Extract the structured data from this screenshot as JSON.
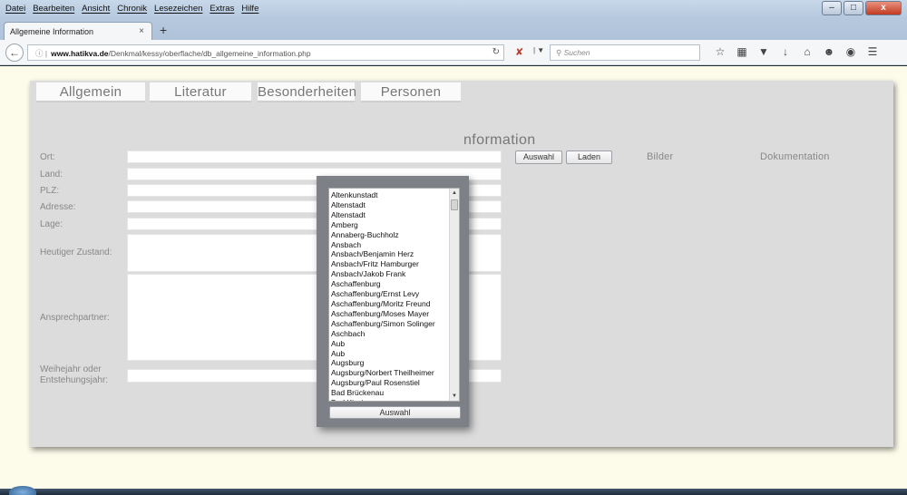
{
  "menubar": {
    "items": [
      "Datei",
      "Bearbeiten",
      "Ansicht",
      "Chronik",
      "Lesezeichen",
      "Extras",
      "Hilfe"
    ]
  },
  "window_controls": {
    "minimize": "–",
    "maximize": "□",
    "close": "x"
  },
  "tab": {
    "title": "Allgemeine Information",
    "close": "×",
    "new_tab": "+"
  },
  "navbar": {
    "url_host": "www.hatikva.de",
    "url_path": "/Denkmal/kessy/oberflache/db_allgemeine_information.php",
    "search_placeholder": "Suchen"
  },
  "page": {
    "tabs": [
      "Allgemein",
      "Literatur",
      "Besonderheiten",
      "Personen"
    ],
    "heading_visible": "nformation",
    "fields": [
      {
        "label": "Ort:"
      },
      {
        "label": "Land:"
      },
      {
        "label": "PLZ:"
      },
      {
        "label": "Adresse:"
      },
      {
        "label": "Lage:"
      },
      {
        "label": "Heutiger Zustand:"
      },
      {
        "label": "Ansprechpartner:"
      },
      {
        "label_line1": "Weihejahr oder",
        "label_line2": "Entstehungsjahr:"
      }
    ],
    "buttons": {
      "auswahl": "Auswahl",
      "laden": "Laden"
    },
    "columns": {
      "bilder": "Bilder",
      "dokumentation": "Dokumentation"
    }
  },
  "modal": {
    "items": [
      "Altenkunstadt",
      "Altenstadt",
      "Altenstadt",
      "Amberg",
      "Annaberg-Buchholz",
      "Ansbach",
      "Ansbach/Benjamin Herz",
      "Ansbach/Fritz Hamburger",
      "Ansbach/Jakob Frank",
      "Aschaffenburg",
      "Aschaffenburg/Ernst Levy",
      "Aschaffenburg/Moritz Freund",
      "Aschaffenburg/Moses Mayer",
      "Aschaffenburg/Simon Solinger",
      "Aschbach",
      "Aub",
      "Aub",
      "Augsburg",
      "Augsburg/Norbert Theilheimer",
      "Augsburg/Paul Rosenstiel",
      "Bad Brückenau",
      "Bad Kissingen"
    ],
    "button_label": "Auswahl"
  }
}
